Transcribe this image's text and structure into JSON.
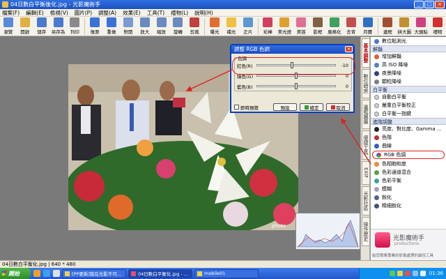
{
  "title": "04日數白平衡後化.jpg - 光影魔術手",
  "menu": [
    "檔案(F)",
    "編輯(E)",
    "檢視(V)",
    "圖片(P)",
    "調整(A)",
    "效果(E)",
    "工具(T)",
    "禮物(L)",
    "說明(H)"
  ],
  "toolbar": [
    {
      "label": "瀏覽",
      "color": "#5a8ad8"
    },
    {
      "label": "開啟",
      "color": "#e0b040"
    },
    {
      "label": "儲存",
      "color": "#4a7ad0"
    },
    {
      "label": "另存為",
      "color": "#4a7ad0"
    },
    {
      "label": "列印",
      "color": "#8a8a8a"
    },
    {
      "label": "復原",
      "color": "#3a72d8"
    },
    {
      "label": "重做",
      "color": "#3a72d8"
    },
    {
      "label": "對開",
      "color": "#7a9ad0"
    },
    {
      "label": "放大",
      "color": "#6a8ac0"
    },
    {
      "label": "縮放",
      "color": "#6a8ac0"
    },
    {
      "label": "旋轉",
      "color": "#6a8ac0"
    },
    {
      "label": "剪裁",
      "color": "#c04040"
    },
    {
      "label": "曝光",
      "color": "#e07030"
    },
    {
      "label": "補光",
      "color": "#f0c040"
    },
    {
      "label": "正片",
      "color": "#5a9ad0"
    },
    {
      "label": "彩棒",
      "color": "#d04060"
    },
    {
      "label": "美光燈",
      "color": "#e0a030"
    },
    {
      "label": "美容",
      "color": "#e07090"
    },
    {
      "label": "影框",
      "color": "#806040"
    },
    {
      "label": "風格化",
      "color": "#40a060"
    },
    {
      "label": "去背",
      "color": "#c05050"
    },
    {
      "label": "月曆",
      "color": "#3070c0"
    },
    {
      "label": "邊框",
      "color": "#a05030"
    },
    {
      "label": "拼大圖",
      "color": "#c09030"
    },
    {
      "label": "大頭貼",
      "color": "#d04080"
    },
    {
      "label": "禮物",
      "color": "#d03030"
    }
  ],
  "side_tabs": [
    "基本調整",
    "數位暗房",
    "邊框圖層",
    "便捷工具",
    "EXIF",
    "光影社區",
    "操作歷史"
  ],
  "panel": {
    "top_item": "數位點測光",
    "sections": [
      {
        "title": "鮮豔",
        "items": [
          "增加鮮豔",
          "高 ISO 降噪",
          "夜景降噪",
          "顆粒降噪"
        ]
      },
      {
        "title": "白平衡",
        "items": [
          "自動白平衡",
          "嚴重白平衡校正",
          "白平衡一指鍵"
        ]
      },
      {
        "title": "進階調整",
        "items": [
          "亮度、對比度、Gamma ...",
          "色階",
          "曲線",
          "RGB 色調",
          "色相飽和度",
          "色彩通道混合",
          "色彩平衡",
          "模糊",
          "銳化",
          "精細銳化"
        ]
      }
    ],
    "highlighted": "RGB 色調",
    "brand_name": "光影魔術手",
    "brand_sub": "productions",
    "brand_tagline": "給您簡單專業的影像處理的最佳工具"
  },
  "dialog": {
    "title": "調整 RGB 色調",
    "group_label": "色調",
    "sliders": [
      {
        "label": "紅色(R)",
        "value": "-10",
        "position": 0.45
      },
      {
        "label": "綠色(G)",
        "value": "0",
        "position": 0.5
      },
      {
        "label": "藍色(B)",
        "value": "0",
        "position": 0.5
      }
    ],
    "realtime_label": "即時預覽",
    "default_label": "預設",
    "ok_label": "確定",
    "cancel_label": "取消"
  },
  "status": "04日數白平衡化.jpg | 640 * 480",
  "taskbar": {
    "start": "開始",
    "tasks": [
      "[PP更新]我在光影不可...",
      "04日數白平衡化.jpg - ...",
      "mobile01"
    ],
    "clock": "01:36"
  }
}
